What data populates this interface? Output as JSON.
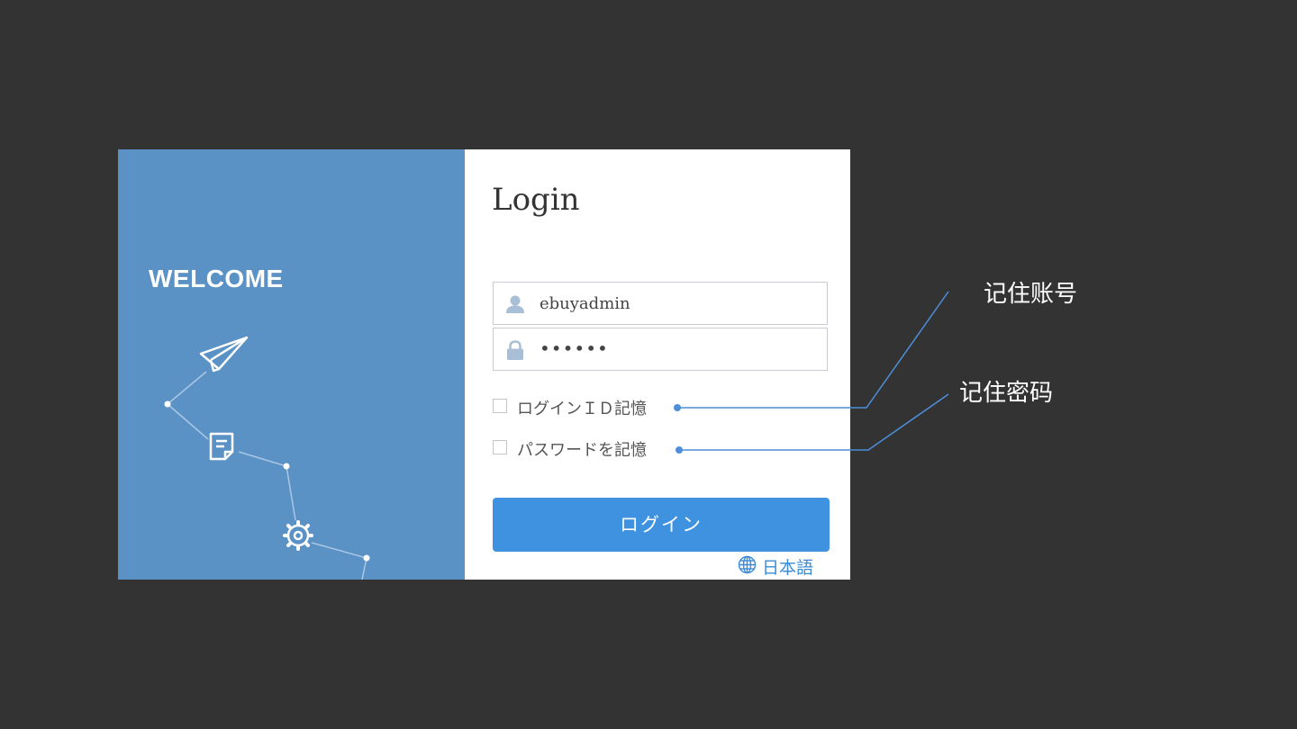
{
  "sidebar": {
    "welcome": "WELCOME",
    "icons": [
      "paper-plane-icon",
      "document-icon",
      "gear-icon"
    ]
  },
  "login": {
    "title": "Login",
    "username": {
      "value": "ebuyadmin",
      "icon": "user-icon"
    },
    "password": {
      "value": "••••••",
      "icon": "lock-icon"
    },
    "remember_id": {
      "label": "ログインＩＤ記憶",
      "checked": false
    },
    "remember_password": {
      "label": "パスワードを記憶",
      "checked": false
    },
    "submit_label": "ログイン",
    "language": {
      "label": "日本語",
      "icon": "globe-icon"
    }
  },
  "annotations": {
    "remember_account": "记住账号",
    "remember_password": "记住密码"
  },
  "colors": {
    "background": "#333333",
    "sidebar": "#5b92c6",
    "button": "#3f92e0",
    "callout_line": "#4d8fd9"
  }
}
